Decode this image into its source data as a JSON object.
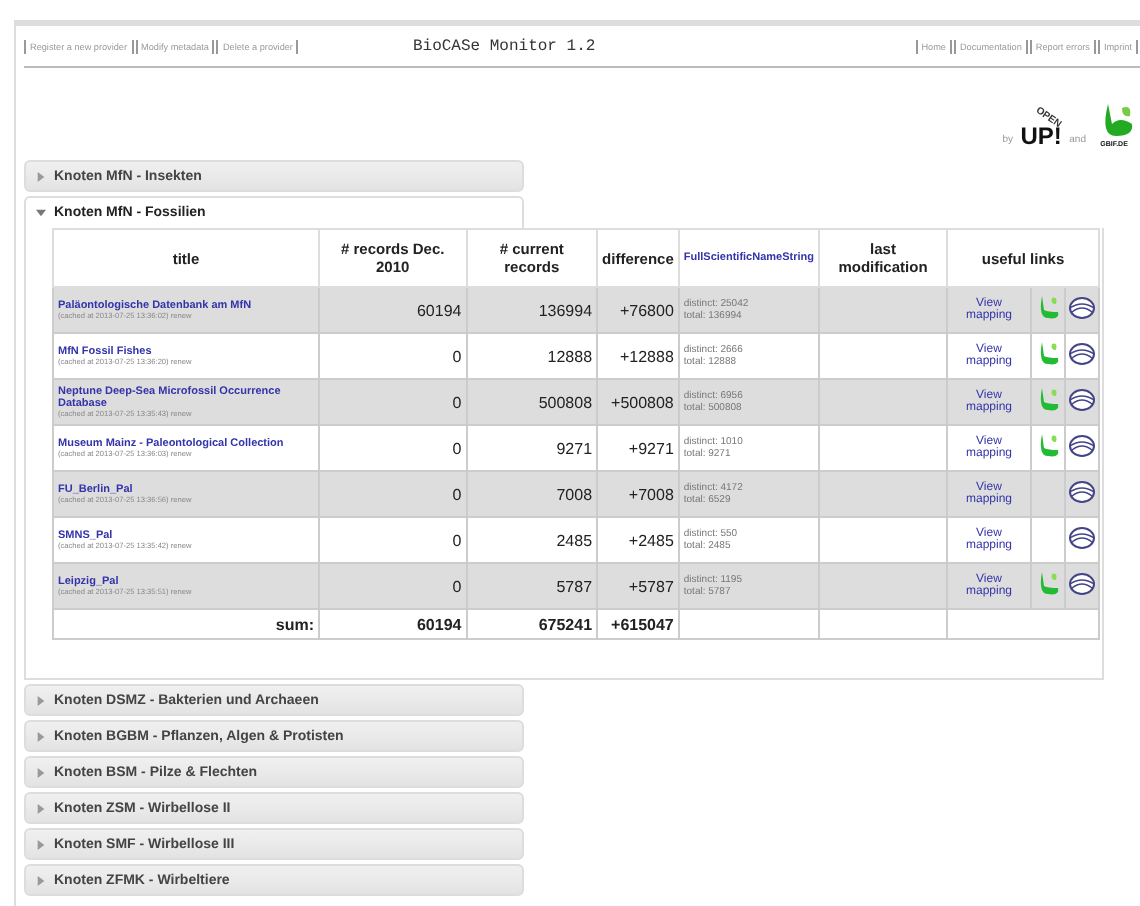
{
  "toolbar": {
    "left_links": [
      "Register a new provider",
      "Modify metadata",
      "Delete a provider"
    ],
    "title": "BioCASe Monitor 1.2",
    "right_links": [
      "Home",
      "Documentation",
      "Report errors",
      "Imprint"
    ]
  },
  "logos": {
    "by": "by",
    "open": "OPEN",
    "up": "UP!",
    "and": "and",
    "gbif": "GBIF.DE"
  },
  "sections": [
    {
      "title": "Knoten MfN - Insekten",
      "expanded": false
    },
    {
      "title": "Knoten MfN - Fossilien",
      "expanded": true,
      "table": {
        "columns": [
          "title",
          "# records Dec. 2010",
          "# current records",
          "difference",
          "FullScientificNameString",
          "last modification",
          "useful links"
        ],
        "rows": [
          {
            "name": "Paläontologische Datenbank am MfN",
            "cached": "(cached at 2013-07-25 13:36:02)",
            "renew": "renew",
            "records_2010": "60194",
            "current": "136994",
            "difference": "+76800",
            "distinct_label": "distinct:",
            "distinct": "25042",
            "total_label": "total:",
            "total": "136994",
            "mapping": "View mapping",
            "gbif": true
          },
          {
            "name": "MfN Fossil Fishes",
            "cached": "(cached at 2013-07-25 13:36:20)",
            "renew": "renew",
            "records_2010": "0",
            "current": "12888",
            "difference": "+12888",
            "distinct_label": "distinct:",
            "distinct": "2666",
            "total_label": "total:",
            "total": "12888",
            "mapping": "View mapping",
            "gbif": true
          },
          {
            "name": "Neptune Deep-Sea Microfossil Occurrence Database",
            "cached": "(cached at 2013-07-25 13:35:43)",
            "renew": "renew",
            "records_2010": "0",
            "current": "500808",
            "difference": "+500808",
            "distinct_label": "distinct:",
            "distinct": "6956",
            "total_label": "total:",
            "total": "500808",
            "mapping": "View mapping",
            "gbif": true
          },
          {
            "name": "Museum Mainz - Paleontological Collection",
            "cached": "(cached at 2013-07-25 13:36:03)",
            "renew": "renew",
            "records_2010": "0",
            "current": "9271",
            "difference": "+9271",
            "distinct_label": "distinct:",
            "distinct": "1010",
            "total_label": "total:",
            "total": "9271",
            "mapping": "View mapping",
            "gbif": true
          },
          {
            "name": "FU_Berlin_Pal",
            "cached": "(cached at 2013-07-25 13:36:56)",
            "renew": "renew",
            "records_2010": "0",
            "current": "7008",
            "difference": "+7008",
            "distinct_label": "distinct:",
            "distinct": "4172",
            "total_label": "total:",
            "total": "6529",
            "mapping": "View mapping",
            "gbif": false
          },
          {
            "name": "SMNS_Pal",
            "cached": "(cached at 2013-07-25 13:35:42)",
            "renew": "renew",
            "records_2010": "0",
            "current": "2485",
            "difference": "+2485",
            "distinct_label": "distinct:",
            "distinct": "550",
            "total_label": "total:",
            "total": "2485",
            "mapping": "View mapping",
            "gbif": false
          },
          {
            "name": "Leipzig_Pal",
            "cached": "(cached at 2013-07-25 13:35:51)",
            "renew": "renew",
            "records_2010": "0",
            "current": "5787",
            "difference": "+5787",
            "distinct_label": "distinct:",
            "distinct": "1195",
            "total_label": "total:",
            "total": "5787",
            "mapping": "View mapping",
            "gbif": true
          }
        ],
        "sum": {
          "label": "sum:",
          "records_2010": "60194",
          "current": "675241",
          "difference": "+615047"
        }
      }
    },
    {
      "title": "Knoten DSMZ - Bakterien und Archaeen",
      "expanded": false
    },
    {
      "title": "Knoten BGBM - Pflanzen, Algen & Protisten",
      "expanded": false
    },
    {
      "title": "Knoten BSM - Pilze & Flechten",
      "expanded": false
    },
    {
      "title": "Knoten ZSM - Wirbellose II",
      "expanded": false
    },
    {
      "title": "Knoten SMF - Wirbellose III",
      "expanded": false
    },
    {
      "title": "Knoten ZFMK - Wirbeltiere",
      "expanded": false
    }
  ]
}
